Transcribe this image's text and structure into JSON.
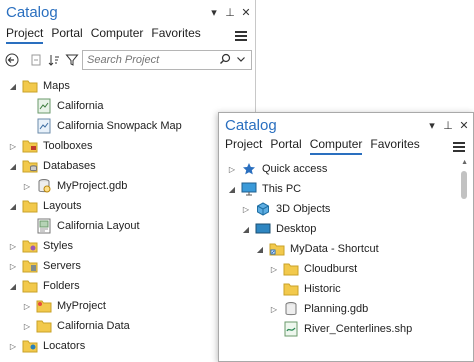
{
  "back": {
    "title": "Catalog",
    "tabs": [
      "Project",
      "Portal",
      "Computer",
      "Favorites"
    ],
    "search_placeholder": "Search Project",
    "items": [
      {
        "label": "Maps",
        "icon": "folder-icon"
      },
      {
        "label": "California",
        "icon": "map-icon"
      },
      {
        "label": "California Snowpack Map",
        "icon": "map-icon"
      },
      {
        "label": "Toolboxes",
        "icon": "toolbox-icon"
      },
      {
        "label": "Databases",
        "icon": "database-icon"
      },
      {
        "label": "MyProject.gdb",
        "icon": "geodatabase-icon"
      },
      {
        "label": "Layouts",
        "icon": "folder-icon"
      },
      {
        "label": "California Layout",
        "icon": "layout-icon"
      },
      {
        "label": "Styles",
        "icon": "styles-icon"
      },
      {
        "label": "Servers",
        "icon": "servers-icon"
      },
      {
        "label": "Folders",
        "icon": "folder-icon"
      },
      {
        "label": "MyProject",
        "icon": "folder-icon"
      },
      {
        "label": "California Data",
        "icon": "folder-icon"
      },
      {
        "label": "Locators",
        "icon": "locator-icon"
      }
    ]
  },
  "front": {
    "title": "Catalog",
    "tabs": [
      "Project",
      "Portal",
      "Computer",
      "Favorites"
    ],
    "items": [
      {
        "label": "Quick access",
        "icon": "star-icon"
      },
      {
        "label": "This PC",
        "icon": "computer-icon"
      },
      {
        "label": "3D Objects",
        "icon": "cube-icon"
      },
      {
        "label": "Desktop",
        "icon": "desktop-icon"
      },
      {
        "label": "MyData - Shortcut",
        "icon": "folder-shortcut-icon"
      },
      {
        "label": "Cloudburst",
        "icon": "folder-icon"
      },
      {
        "label": "Historic",
        "icon": "folder-icon"
      },
      {
        "label": "Planning.gdb",
        "icon": "geodatabase-icon"
      },
      {
        "label": "River_Centerlines.shp",
        "icon": "shapefile-icon"
      }
    ]
  },
  "colors": {
    "accent": "#2a6fbf",
    "folder": "#f2c94c"
  }
}
